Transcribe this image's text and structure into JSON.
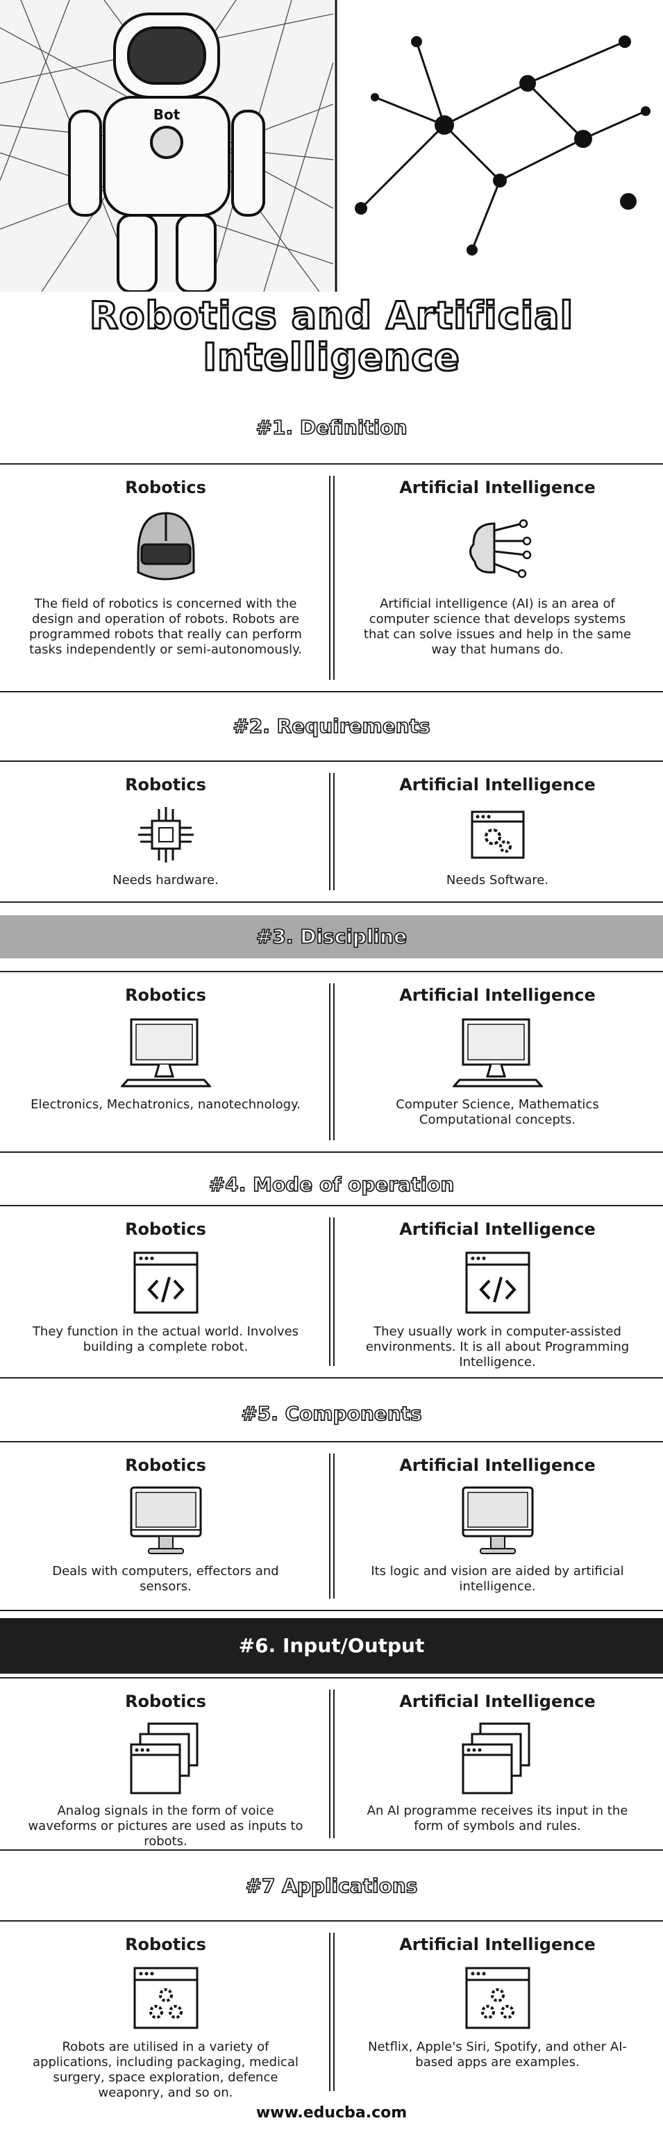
{
  "title_line1": "Robotics and Artificial",
  "title_line2": "Intelligence",
  "hero": {
    "robot_badge": "Bot"
  },
  "sections": [
    {
      "heading": "#1. Definition",
      "left": {
        "title": "Robotics",
        "icon": "robot-head-icon",
        "text": "The field of robotics is concerned with the design and operation of robots. Robots are programmed robots that really can perform tasks independently or semi-autonomously."
      },
      "right": {
        "title": "Artificial Intelligence",
        "icon": "brain-circuit-icon",
        "text": "Artificial intelligence (AI) is an area of computer science that develops systems that can solve issues and help in the same way that humans do."
      }
    },
    {
      "heading": "#2. Requirements",
      "left": {
        "title": "Robotics",
        "icon": "microchip-icon",
        "text": "Needs hardware."
      },
      "right": {
        "title": "Artificial Intelligence",
        "icon": "software-window-gears-icon",
        "text": "Needs Software."
      }
    },
    {
      "heading": "#3. Discipline",
      "left": {
        "title": "Robotics",
        "icon": "computer-monitor-icon",
        "text": "Electronics, Mechatronics, nanotechnology."
      },
      "right": {
        "title": "Artificial Intelligence",
        "icon": "computer-monitor-icon",
        "text": "Computer Science, Mathematics Computational concepts."
      }
    },
    {
      "heading": "#4. Mode of operation",
      "left": {
        "title": "Robotics",
        "icon": "code-window-icon",
        "text": "They function in the actual world. Involves building a complete robot."
      },
      "right": {
        "title": "Artificial Intelligence",
        "icon": "code-window-icon",
        "text": "They usually work in computer-assisted environments. It is all about Programming Intelligence."
      }
    },
    {
      "heading": "#5. Components",
      "left": {
        "title": "Robotics",
        "icon": "desktop-computer-icon",
        "text": "Deals with computers, effectors and sensors."
      },
      "right": {
        "title": "Artificial Intelligence",
        "icon": "desktop-computer-icon",
        "text": "Its logic and vision are aided by artificial intelligence."
      }
    },
    {
      "heading": "#6. Input/Output",
      "left": {
        "title": "Robotics",
        "icon": "stacked-windows-icon",
        "text": "Analog signals in the form of voice waveforms or pictures are used as inputs to robots."
      },
      "right": {
        "title": "Artificial Intelligence",
        "icon": "stacked-windows-icon",
        "text": "An AI programme receives its input in the form of symbols and rules."
      }
    },
    {
      "heading": "#7  Applications",
      "left": {
        "title": "Robotics",
        "icon": "window-gears-icon",
        "text": "Robots are utilised in a variety of applications, including packaging, medical surgery, space exploration, defence weaponry, and so on."
      },
      "right": {
        "title": "Artificial Intelligence",
        "icon": "window-gears-icon",
        "text": "Netflix, Apple's Siri, Spotify, and other AI-based apps are examples."
      }
    }
  ],
  "footer": "www.educba.com"
}
